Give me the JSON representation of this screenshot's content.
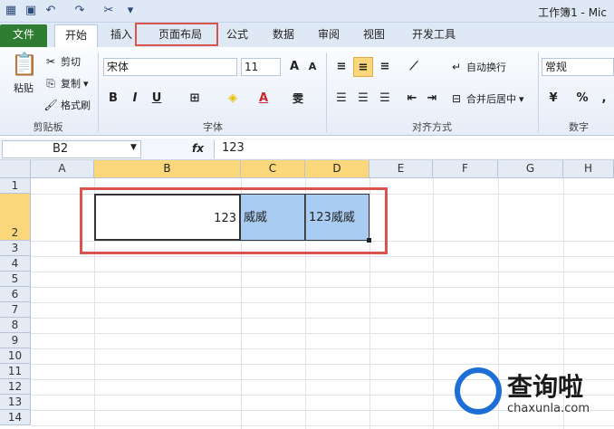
{
  "window": {
    "title": "工作簿1 - Mic"
  },
  "ribbon_tabs": [
    "文件",
    "开始",
    "插入",
    "页面布局",
    "公式",
    "数据",
    "审阅",
    "视图",
    "开发工具"
  ],
  "clipboard": {
    "paste": "粘贴",
    "cut": "剪切",
    "copy": "复制",
    "format_painter": "格式刷",
    "label": "剪贴板"
  },
  "font": {
    "name": "宋体",
    "size": "11",
    "label": "字体"
  },
  "alignment": {
    "wrap": "自动换行",
    "merge": "合并后居中",
    "label": "对齐方式"
  },
  "number": {
    "format": "常规",
    "label": "数字"
  },
  "formula_bar": {
    "name_box": "B2",
    "fx": "fx",
    "value": "123"
  },
  "columns": [
    "A",
    "B",
    "C",
    "D",
    "E",
    "F",
    "G",
    "H"
  ],
  "rows": [
    "1",
    "2",
    "3",
    "4",
    "5",
    "6",
    "7",
    "8",
    "9",
    "10",
    "11",
    "12",
    "13",
    "14"
  ],
  "cells": {
    "B2": "123",
    "C2": "威威",
    "D2": "123威威"
  },
  "watermark": {
    "brand": "查询啦",
    "url": "chaxunla.com"
  },
  "colors": {
    "accent_red": "#d9534f",
    "selection_blue": "#a9cdf2",
    "file_tab": "#2e7d32"
  }
}
